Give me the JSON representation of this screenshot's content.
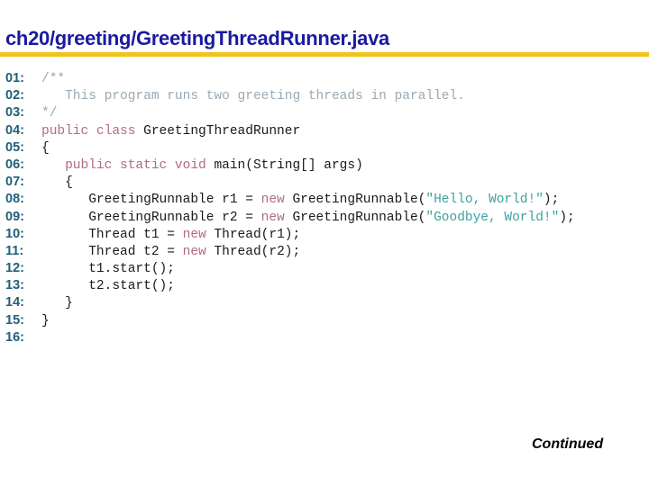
{
  "title": "ch20/greeting/GreetingThreadRunner.java",
  "accent_color": "#f2c318",
  "code": {
    "lines": [
      {
        "num": "01:",
        "tokens": [
          {
            "t": "comment",
            "v": "/**"
          }
        ]
      },
      {
        "num": "02:",
        "tokens": [
          {
            "t": "comment",
            "v": "   This program runs two greeting threads in parallel."
          }
        ]
      },
      {
        "num": "03:",
        "tokens": [
          {
            "t": "comment",
            "v": "*/"
          }
        ]
      },
      {
        "num": "04:",
        "tokens": [
          {
            "t": "kw",
            "v": "public class "
          },
          {
            "t": "plain",
            "v": "GreetingThreadRunner"
          }
        ]
      },
      {
        "num": "05:",
        "tokens": [
          {
            "t": "plain",
            "v": "{"
          }
        ]
      },
      {
        "num": "06:",
        "tokens": [
          {
            "t": "plain",
            "v": "   "
          },
          {
            "t": "kw",
            "v": "public static void "
          },
          {
            "t": "plain",
            "v": "main(String[] args)"
          }
        ]
      },
      {
        "num": "07:",
        "tokens": [
          {
            "t": "plain",
            "v": "   {"
          }
        ]
      },
      {
        "num": "08:",
        "tokens": [
          {
            "t": "plain",
            "v": "      GreetingRunnable r1 = "
          },
          {
            "t": "kw",
            "v": "new "
          },
          {
            "t": "plain",
            "v": "GreetingRunnable("
          },
          {
            "t": "str",
            "v": "\"Hello, World!\""
          },
          {
            "t": "plain",
            "v": ");"
          }
        ]
      },
      {
        "num": "09:",
        "tokens": [
          {
            "t": "plain",
            "v": "      GreetingRunnable r2 = "
          },
          {
            "t": "kw",
            "v": "new "
          },
          {
            "t": "plain",
            "v": "GreetingRunnable("
          },
          {
            "t": "str",
            "v": "\"Goodbye, World!\""
          },
          {
            "t": "plain",
            "v": ");"
          }
        ]
      },
      {
        "num": "10:",
        "tokens": [
          {
            "t": "plain",
            "v": "      Thread t1 = "
          },
          {
            "t": "kw",
            "v": "new "
          },
          {
            "t": "plain",
            "v": "Thread(r1);"
          }
        ]
      },
      {
        "num": "11:",
        "tokens": [
          {
            "t": "plain",
            "v": "      Thread t2 = "
          },
          {
            "t": "kw",
            "v": "new "
          },
          {
            "t": "plain",
            "v": "Thread(r2);"
          }
        ]
      },
      {
        "num": "12:",
        "tokens": [
          {
            "t": "plain",
            "v": "      t1.start();"
          }
        ]
      },
      {
        "num": "13:",
        "tokens": [
          {
            "t": "plain",
            "v": "      t2.start();"
          }
        ]
      },
      {
        "num": "14:",
        "tokens": [
          {
            "t": "plain",
            "v": "   }"
          }
        ]
      },
      {
        "num": "15:",
        "tokens": [
          {
            "t": "plain",
            "v": "}"
          }
        ]
      },
      {
        "num": "16:",
        "tokens": []
      }
    ]
  },
  "footer": {
    "continued": "Continued"
  }
}
